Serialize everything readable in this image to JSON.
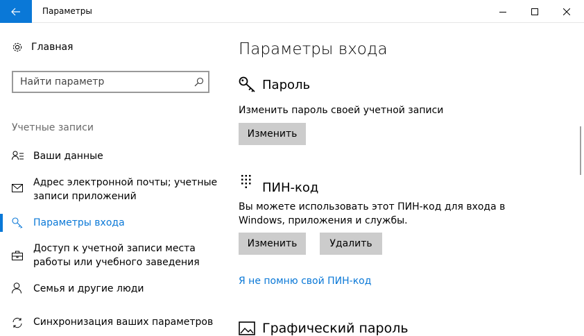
{
  "window": {
    "title": "Параметры",
    "accent": "#0a78d7"
  },
  "sidebar": {
    "home_label": "Главная",
    "search": {
      "placeholder": "Найти параметр"
    },
    "section_header": "Учетные записи",
    "items": [
      {
        "label": "Ваши данные",
        "icon": "person-list-icon"
      },
      {
        "label": "Адрес электронной почты; учетные записи приложений",
        "icon": "envelope-icon"
      },
      {
        "label": "Параметры входа",
        "icon": "key-icon",
        "selected": true
      },
      {
        "label": "Доступ к учетной записи места работы или учебного заведения",
        "icon": "briefcase-icon"
      },
      {
        "label": "Семья и другие люди",
        "icon": "person-icon"
      },
      {
        "label": "Синхронизация ваших параметров",
        "icon": "sync-icon"
      }
    ]
  },
  "main": {
    "page_title": "Параметры входа",
    "password": {
      "title": "Пароль",
      "description": "Изменить пароль своей учетной записи",
      "change_button": "Изменить"
    },
    "pin": {
      "title": "ПИН-код",
      "description": "Вы можете использовать этот ПИН-код для входа в Windows, приложения и службы.",
      "change_button": "Изменить",
      "remove_button": "Удалить",
      "forgot_link": "Я не помню свой ПИН-код"
    },
    "picture_password": {
      "title": "Графический пароль"
    }
  }
}
